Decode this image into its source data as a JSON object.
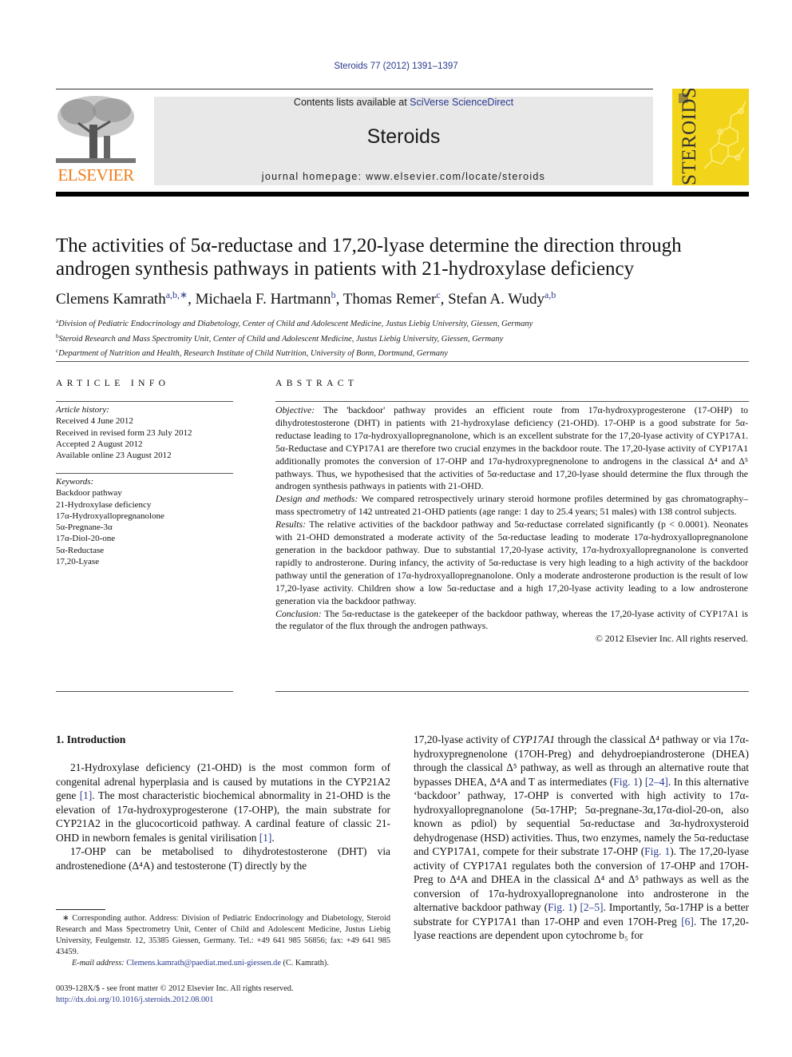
{
  "header": {
    "citation": "Steroids 77 (2012) 1391–1397",
    "contents_prefix": "Contents lists available at ",
    "contents_link": "SciVerse ScienceDirect",
    "journal_title": "Steroids",
    "homepage": "journal homepage: www.elsevier.com/locate/steroids",
    "publisher_logo_text": "ELSEVIER",
    "cover_title": "STEROIDS",
    "colors": {
      "publisher_orange": "#f07d1a",
      "cover_yellow": "#f2d51a",
      "link_blue": "#2a3a8f",
      "banner_gray": "#e8e8e8"
    }
  },
  "article": {
    "title": "The activities of 5α-reductase and 17,20-lyase determine the direction through androgen synthesis pathways in patients with 21-hydroxylase deficiency",
    "authors": [
      {
        "name": "Clemens Kamrath",
        "sup": "a,b,∗",
        "sep": ", "
      },
      {
        "name": "Michaela F. Hartmann",
        "sup": "b",
        "sep": ", "
      },
      {
        "name": "Thomas Remer",
        "sup": "c",
        "sep": ", "
      },
      {
        "name": "Stefan A. Wudy",
        "sup": "a,b",
        "sep": ""
      }
    ],
    "affiliations": [
      {
        "mark": "a",
        "text": "Division of Pediatric Endocrinology and Diabetology, Center of Child and Adolescent Medicine, Justus Liebig University, Giessen, Germany"
      },
      {
        "mark": "b",
        "text": "Steroid Research and Mass Spectromity Unit, Center of Child and Adolescent Medicine, Justus Liebig University, Giessen, Germany"
      },
      {
        "mark": "c",
        "text": "Department of Nutrition and Health, Research Institute of Child Nutrition, University of Bonn, Dortmund, Germany"
      }
    ]
  },
  "article_info": {
    "heading": "ARTICLE INFO",
    "history_label": "Article history:",
    "history": [
      "Received 4 June 2012",
      "Received in revised form 23 July 2012",
      "Accepted 2 August 2012",
      "Available online 23 August 2012"
    ],
    "keywords_label": "Keywords:",
    "keywords": [
      "Backdoor pathway",
      "21-Hydroxylase deficiency",
      "17α-Hydroxyallopregnanolone",
      "5α-Pregnane-3α",
      "17α-Diol-20-one",
      "5α-Reductase",
      "17,20-Lyase"
    ]
  },
  "abstract": {
    "heading": "ABSTRACT",
    "sections": [
      {
        "label": "Objective:",
        "text": " The 'backdoor' pathway provides an efficient route from 17α-hydroxyprogesterone (17-OHP) to dihydrotestosterone (DHT) in patients with 21-hydroxylase deficiency (21-OHD). 17-OHP is a good substrate for 5α-reductase leading to 17α-hydroxyallopregnanolone, which is an excellent substrate for the 17,20-lyase activity of CYP17A1. 5α-Reductase and CYP17A1 are therefore two crucial enzymes in the backdoor route. The 17,20-lyase activity of CYP17A1 additionally promotes the conversion of 17-OHP and 17α-hydroxypregnenolone to androgens in the classical Δ⁴ and Δ⁵ pathways. Thus, we hypothesised that the activities of 5α-reductase and 17,20-lyase should determine the flux through the androgen synthesis pathways in patients with 21-OHD."
      },
      {
        "label": "Design and methods:",
        "text": " We compared retrospectively urinary steroid hormone profiles determined by gas chromatography–mass spectrometry of 142 untreated 21-OHD patients (age range: 1 day to 25.4 years; 51 males) with 138 control subjects."
      },
      {
        "label": "Results:",
        "text": " The relative activities of the backdoor pathway and 5α-reductase correlated significantly (p < 0.0001). Neonates with 21-OHD demonstrated a moderate activity of the 5α-reductase leading to moderate 17α-hydroxyallopregnanolone generation in the backdoor pathway. Due to substantial 17,20-lyase activity, 17α-hydroxyallopregnanolone is converted rapidly to androsterone. During infancy, the activity of 5α-reductase is very high leading to a high activity of the backdoor pathway until the generation of 17α-hydroxyallopregnanolone. Only a moderate androsterone production is the result of low 17,20-lyase activity. Children show a low 5α-reductase and a high 17,20-lyase activity leading to a low androsterone generation via the backdoor pathway."
      },
      {
        "label": "Conclusion:",
        "text": " The 5α-reductase is the gatekeeper of the backdoor pathway, whereas the 17,20-lyase activity of CYP17A1 is the regulator of the flux through the androgen pathways."
      }
    ],
    "copyright": "© 2012 Elsevier Inc. All rights reserved."
  },
  "introduction": {
    "heading": "1. Introduction",
    "left_paragraphs": [
      [
        {
          "t": "21-Hydroxylase deficiency (21-OHD) is the most common form of congenital adrenal hyperplasia and is caused by mutations in the CYP21A2 gene "
        },
        {
          "t": "[1]",
          "link": true
        },
        {
          "t": ". The most characteristic biochemical abnormality in 21-OHD is the elevation of 17α-hydroxyprogesterone (17-OHP), the main substrate for CYP21A2 in the glucocorticoid pathway. A cardinal feature of classic 21-OHD in newborn females is genital virilisation "
        },
        {
          "t": "[1]",
          "link": true
        },
        {
          "t": "."
        }
      ],
      [
        {
          "t": "17-OHP can be metabolised to dihydrotestosterone (DHT) via androstenedione (Δ⁴A) and testosterone (T) directly by the"
        }
      ]
    ],
    "right_paragraph": [
      {
        "t": "17,20-lyase activity of "
      },
      {
        "t": "CYP17A1",
        "italic": true
      },
      {
        "t": " through the classical Δ⁴ pathway or via 17α-hydroxypregnenolone (17OH-Preg) and dehydroepiandrosterone (DHEA) through the classical Δ⁵ pathway, as well as through an alternative route that bypasses DHEA, Δ⁴A and T as intermediates ("
      },
      {
        "t": "Fig. 1",
        "link": true
      },
      {
        "t": ") "
      },
      {
        "t": "[2–4]",
        "link": true
      },
      {
        "t": ". In this alternative ‘backdoor’ pathway, 17-OHP is converted with high activity to 17α-hydroxyallopregnanolone (5α-17HP; 5α-pregnane-3α,17α-diol-20-on, also known as pdiol) by sequential 5α-reductase and 3α-hydroxysteroid dehydrogenase (HSD) activities. Thus, two enzymes, namely the 5α-reductase and CYP17A1, compete for their substrate 17-OHP ("
      },
      {
        "t": "Fig. 1",
        "link": true
      },
      {
        "t": "). The 17,20-lyase activity of CYP17A1 regulates both the conversion of 17-OHP and 17OH-Preg to Δ⁴A and DHEA in the classical Δ⁴ and Δ⁵ pathways as well as the conversion of 17α-hydroxyallopregnanolone into androsterone in the alternative backdoor pathway ("
      },
      {
        "t": "Fig. 1",
        "link": true
      },
      {
        "t": ") "
      },
      {
        "t": "[2–5]",
        "link": true
      },
      {
        "t": ". Importantly, 5α-17HP is a better substrate for CYP17A1 than 17-OHP and even 17OH-Preg "
      },
      {
        "t": "[6]",
        "link": true
      },
      {
        "t": ". The 17,20-lyase reactions are dependent upon cytochrome b₅ for"
      }
    ]
  },
  "footnote": {
    "corresponding": "∗ Corresponding author. Address: Division of Pediatric Endocrinology and Diabetology, Steroid Research and Mass Spectrometry Unit, Center of Child and Adolescent Medicine, Justus Liebig University, Feulgenstr. 12, 35385 Giessen, Germany. Tel.: +49 641 985 56856; fax: +49 641 985 43459.",
    "email_label": "E-mail address:",
    "email": "Clemens.kamrath@paediat.med.uni-giessen.de",
    "email_suffix": " (C. Kamrath)."
  },
  "footer": {
    "issn_line": "0039-128X/$ - see front matter © 2012 Elsevier Inc. All rights reserved.",
    "doi": "http://dx.doi.org/10.1016/j.steroids.2012.08.001"
  }
}
